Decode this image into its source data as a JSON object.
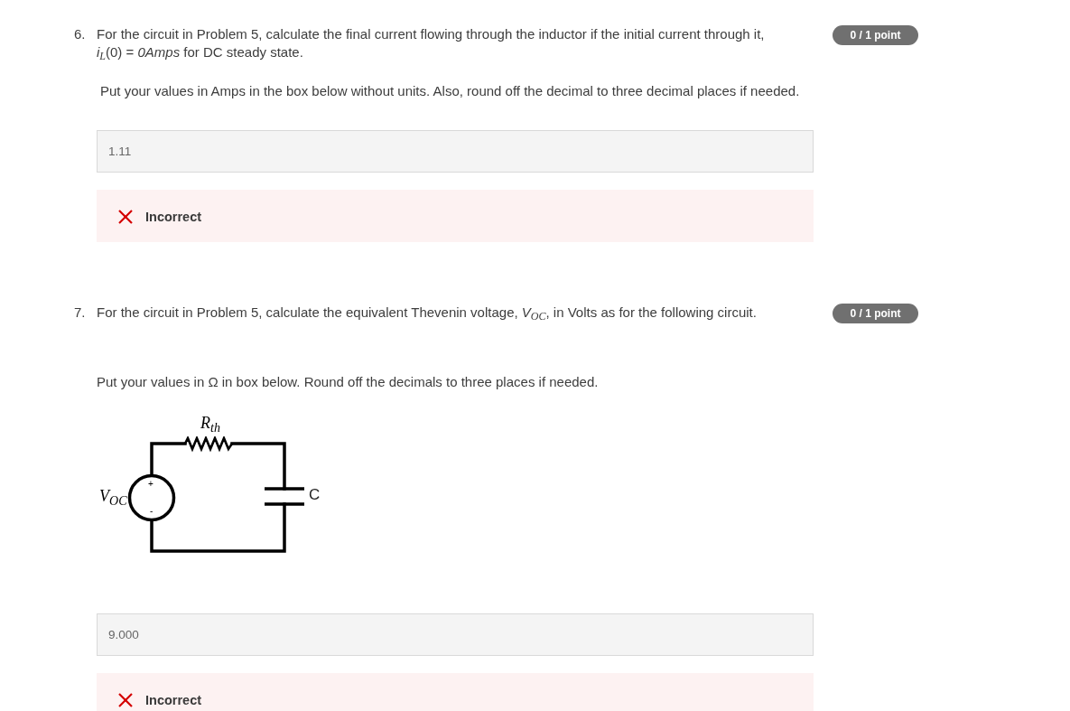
{
  "questions": [
    {
      "number": "6.",
      "text": "For the circuit in Problem 5, calculate the final current flowing through the inductor if the initial current through it, *i*$_{L}$(0) = *0Amps* for DC steady state.",
      "score": "0 / 1 point",
      "instructions": "Put your values in Amps in the box below without units. Also, round off the decimal to three decimal places if needed.",
      "answer": {
        "value": "1.11"
      },
      "feedback": {
        "correct": false,
        "label": "Incorrect"
      }
    },
    {
      "number": "7.",
      "text": "For the circuit in Problem 5, calculate the equivalent Thevenin voltage, *V*$_{OC}$, in Volts as for the following circuit.",
      "score": "0 / 1 point",
      "instructions": "Put your values in Ω in box below. Round off the decimals to three places if needed.",
      "figure": {
        "kind": "circuit",
        "labels": [
          {
            "kind": "resistor",
            "text": "R$_{th}$"
          },
          {
            "kind": "source",
            "text": "V$_{OC}$"
          },
          {
            "kind": "plus",
            "text": "+"
          },
          {
            "kind": "minus",
            "text": "-"
          },
          {
            "kind": "capacitor",
            "text": "C"
          }
        ]
      },
      "answer": {
        "value": "9.000"
      },
      "feedback": {
        "correct": false,
        "label": "Incorrect"
      }
    }
  ]
}
